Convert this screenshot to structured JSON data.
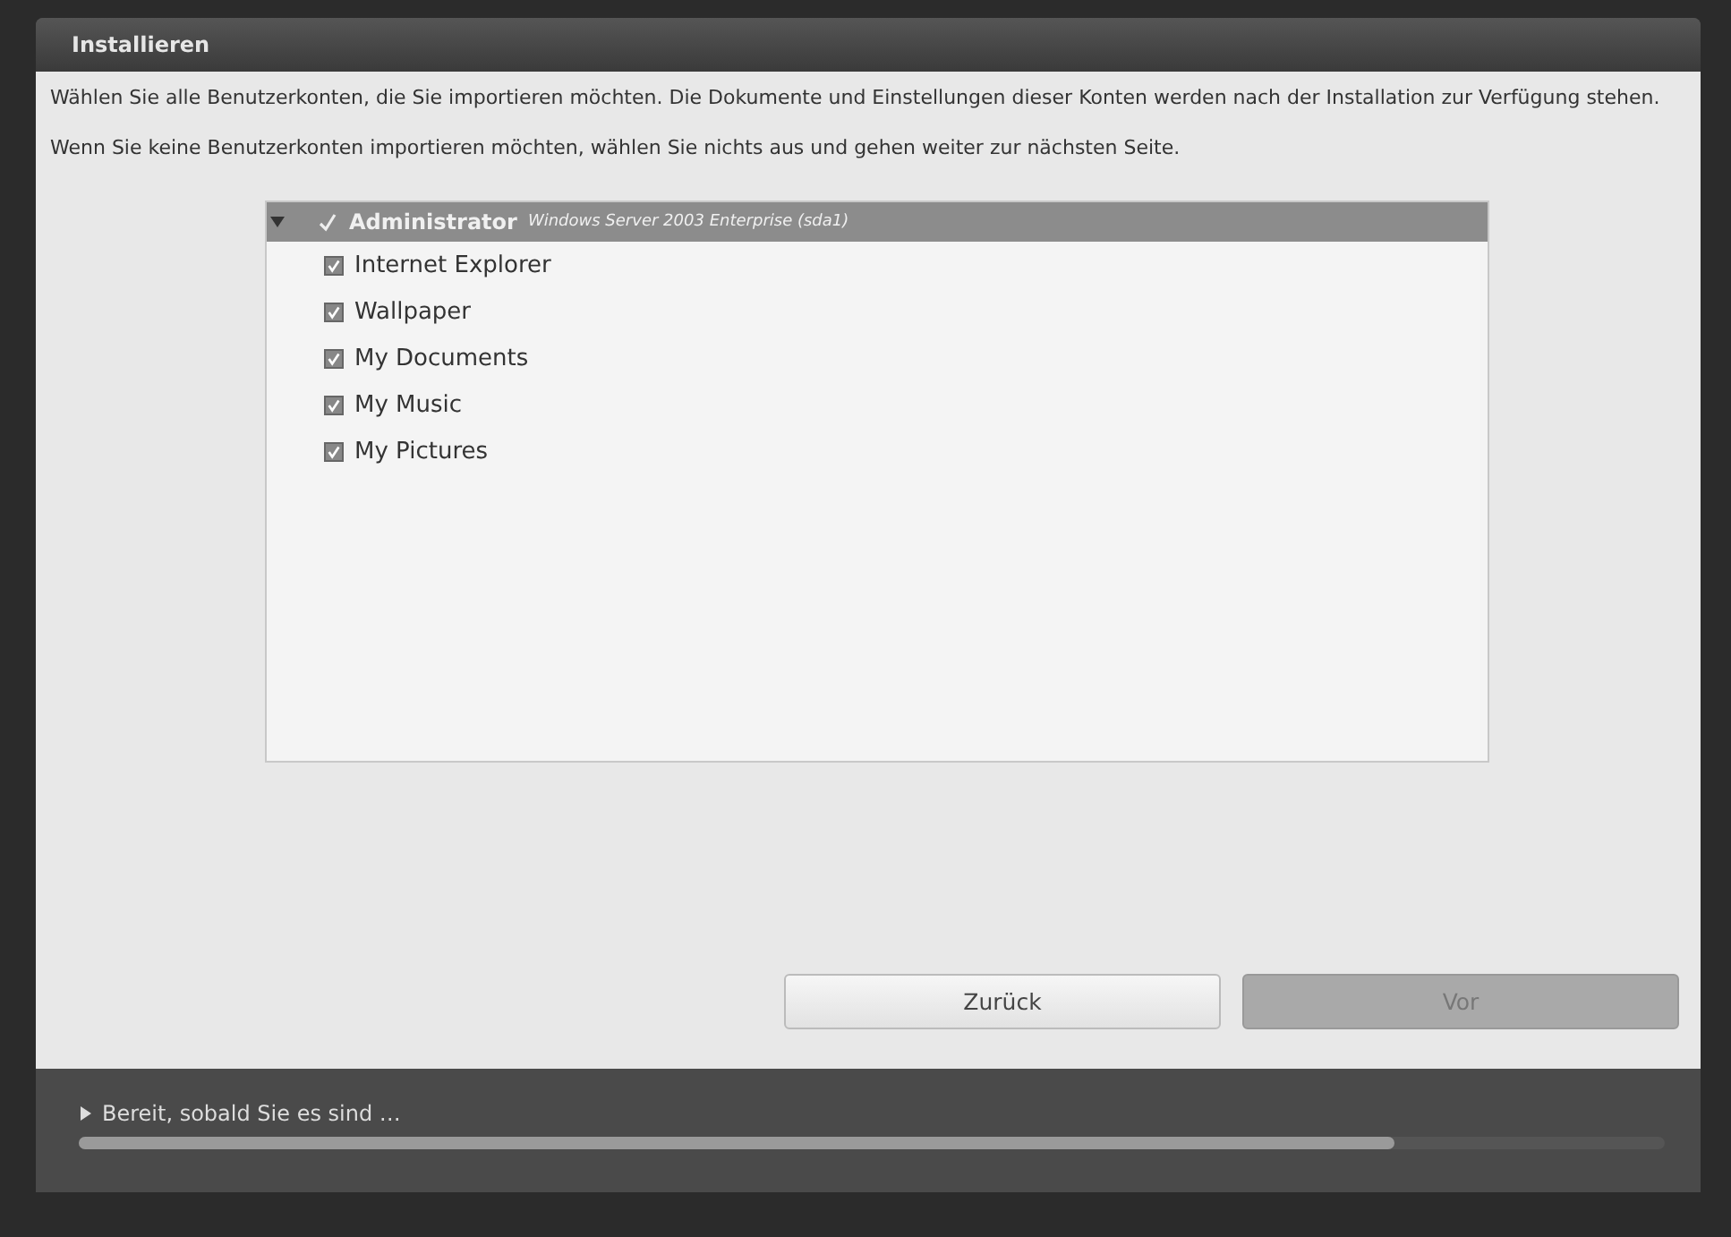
{
  "window": {
    "title": "Installieren"
  },
  "intro": [
    "Wählen Sie alle Benutzerkonten, die Sie importieren möchten. Die Dokumente und Einstellungen dieser Konten werden nach der Installation zur Verfügung stehen.",
    "Wenn Sie keine Benutzerkonten importieren möchten, wählen Sie nichts aus und gehen weiter zur nächsten Seite."
  ],
  "accounts": [
    {
      "name": "Administrator",
      "detail": "Windows Server 2003 Enterprise (sda1)",
      "checked": true,
      "expanded": true,
      "selected": true,
      "children": [
        {
          "name": "Internet Explorer",
          "checked": true
        },
        {
          "name": "Wallpaper",
          "checked": true
        },
        {
          "name": "My Documents",
          "checked": true
        },
        {
          "name": "My Music",
          "checked": true
        },
        {
          "name": "My Pictures",
          "checked": true
        }
      ]
    }
  ],
  "buttons": [
    {
      "label": "Zurück",
      "disabled": false
    },
    {
      "label": "Vor",
      "disabled": true
    }
  ],
  "status": {
    "expanded": false,
    "text": "Bereit, sobald Sie es sind …",
    "progress": {
      "level": 0.83
    }
  }
}
